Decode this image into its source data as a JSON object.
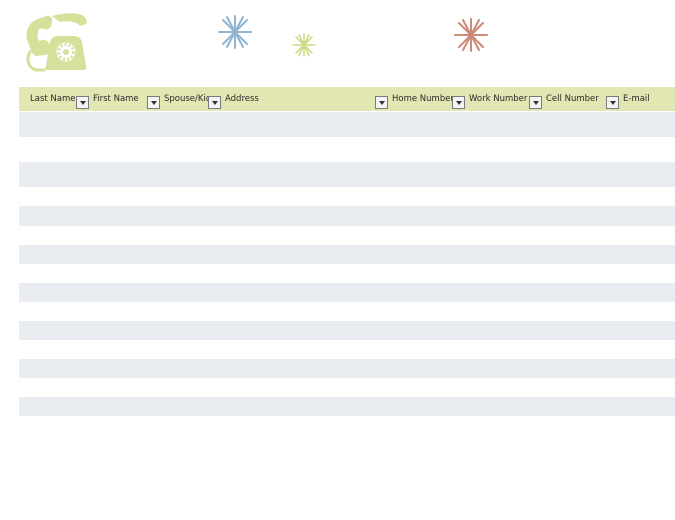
{
  "decor": {
    "phone_color": "#d6e09a",
    "star_colors": {
      "blue": "#8fb4d2",
      "green": "#cddc86",
      "red": "#cc8b78"
    }
  },
  "table": {
    "header_bg": "#e2e6b2",
    "stripe_bg": "#e9ecf1",
    "columns": [
      {
        "label": "Last Name"
      },
      {
        "label": "First Name"
      },
      {
        "label": "Spouse/Kids"
      },
      {
        "label": "Address"
      },
      {
        "label": "Home Number"
      },
      {
        "label": "Work Number"
      },
      {
        "label": "Cell Number"
      },
      {
        "label": "E-mail"
      }
    ]
  }
}
